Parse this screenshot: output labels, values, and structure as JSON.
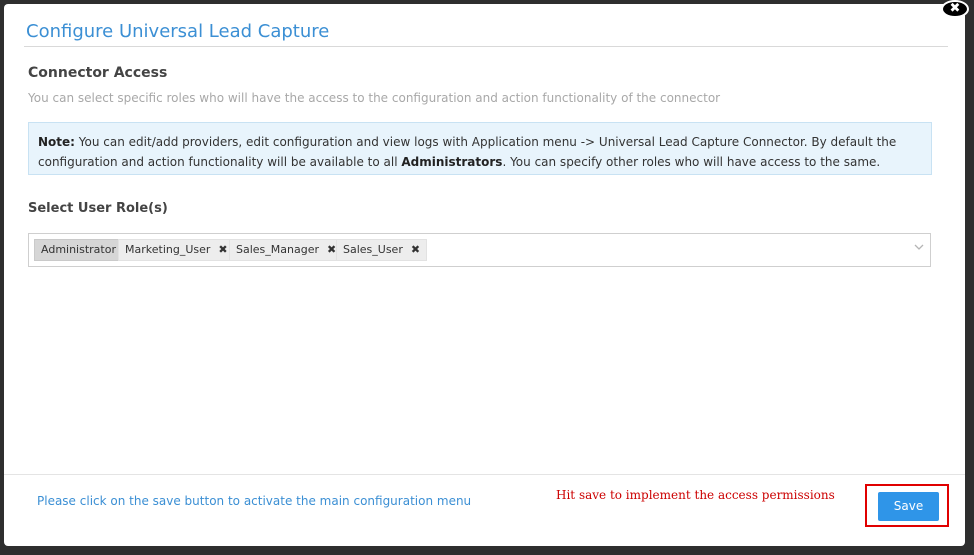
{
  "dialog": {
    "title": "Configure Universal Lead Capture",
    "close_glyph": "✖"
  },
  "connector_access": {
    "heading": "Connector Access",
    "description": "You can select specific roles who will have the access to the configuration and action functionality of the connector"
  },
  "note": {
    "label": "Note:",
    "text_before": " You can edit/add providers, edit configuration and view logs with Application menu -> Universal Lead Capture Connector. By default the configuration and action functionality will be available to all ",
    "emphasis": "Administrators",
    "text_after": ". You can specify other roles who will have access to the same."
  },
  "roles": {
    "label": "Select User Role(s)",
    "selected": [
      {
        "name": "Administrator",
        "removable": false
      },
      {
        "name": "Marketing_User",
        "removable": true
      },
      {
        "name": "Sales_Manager",
        "removable": true
      },
      {
        "name": "Sales_User",
        "removable": true
      }
    ],
    "remove_glyph": "✖",
    "dropdown_icon": "chevron-down-icon"
  },
  "footer": {
    "info_text": "Please click on the save button to activate the main configuration menu",
    "annotation": "Hit save to implement the access permissions",
    "save_label": "Save"
  },
  "colors": {
    "title_blue": "#3b8fd4",
    "save_button": "#2f95e8",
    "annotation_red": "#cc0000",
    "note_background": "#e8f4fc"
  }
}
